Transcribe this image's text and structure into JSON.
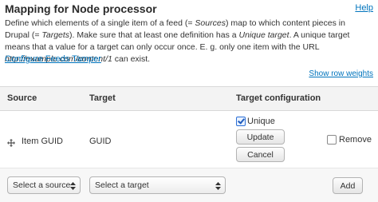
{
  "header": {
    "title": "Mapping for Node processor",
    "help_link": "Help"
  },
  "description": {
    "part1": "Define which elements of a single item of a feed (= ",
    "sources_term": "Sources",
    "part2": ") map to which content pieces in Drupal (= ",
    "targets_term": "Targets",
    "part3": "). Make sure that at least one definition has a ",
    "unique_target_term": "Unique target",
    "part4": ". A unique target means that a value for a target can only occur once. E. g. only one item with the URL ",
    "example_url": "http://example.com/content/1",
    "part5": " can exist."
  },
  "links": {
    "configure_tamper": "Configure Feeds Tamper",
    "show_row_weights": "Show row weights"
  },
  "table": {
    "headers": [
      "Source",
      "Target",
      "Target configuration"
    ],
    "row": {
      "source": "Item GUID",
      "target": "GUID",
      "unique_label": "Unique",
      "unique_checked": true,
      "update_button": "Update",
      "cancel_button": "Cancel",
      "remove_label": "Remove",
      "remove_checked": false
    },
    "add_row": {
      "source_select": "Select a source",
      "target_select": "Select a target",
      "add_button": "Add"
    }
  },
  "colors": {
    "link": "#0074bd",
    "header_bg": "#f3f3f3",
    "checkbox_checked": "#2c6fd6"
  },
  "icons": {
    "drag_handle": "move-cross-icon",
    "select_arrows": "updown-chevron-icon"
  }
}
